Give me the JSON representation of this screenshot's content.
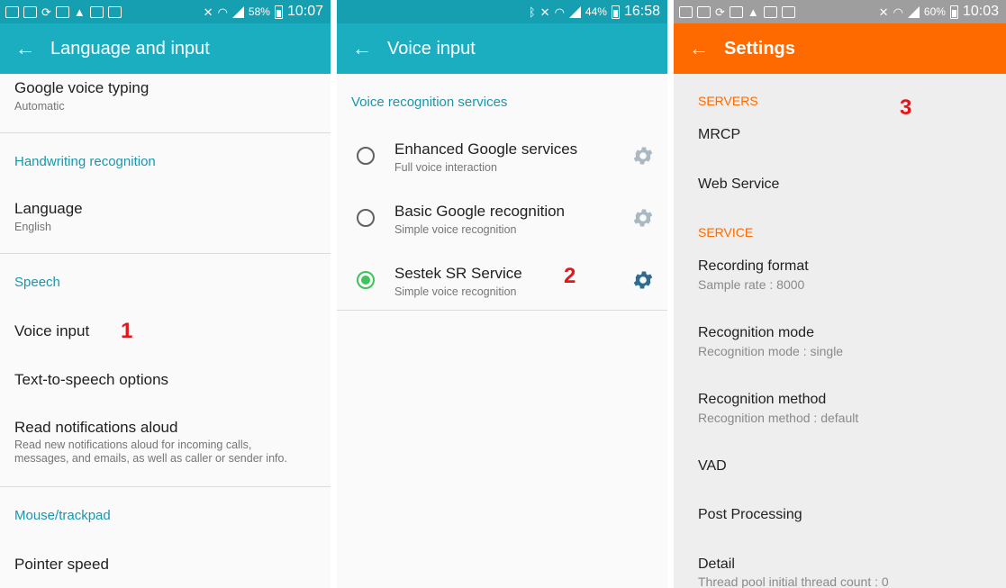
{
  "panel1": {
    "status_battery": "58%",
    "status_time": "10:07",
    "title": "Language and input",
    "google_voice_typing": {
      "title": "Google voice typing",
      "sub": "Automatic"
    },
    "handwriting_header": "Handwriting recognition",
    "language": {
      "title": "Language",
      "sub": "English"
    },
    "speech_header": "Speech",
    "voice_input": "Voice input",
    "marker": "1",
    "tts_options": "Text-to-speech options",
    "read_notifications": {
      "title": "Read notifications aloud",
      "sub1": "Read new notifications aloud for incoming calls,",
      "sub2": "messages, and emails, as well as caller or sender info."
    },
    "mouse_header": "Mouse/trackpad",
    "pointer_speed": "Pointer speed"
  },
  "panel2": {
    "status_battery": "44%",
    "status_time": "16:58",
    "title": "Voice input",
    "section_header": "Voice recognition services",
    "services": [
      {
        "title": "Enhanced Google services",
        "sub": "Full voice interaction",
        "selected": false
      },
      {
        "title": "Basic Google recognition",
        "sub": "Simple voice recognition",
        "selected": false
      },
      {
        "title": "Sestek SR Service",
        "sub": "Simple voice recognition",
        "selected": true
      }
    ],
    "marker": "2"
  },
  "panel3": {
    "status_battery": "60%",
    "status_time": "10:03",
    "title": "Settings",
    "servers_header": "SERVERS",
    "marker": "3",
    "mrcp": "MRCP",
    "web_service": "Web Service",
    "service_header": "SERVICE",
    "recording_format": {
      "title": "Recording format",
      "sub": "Sample rate : 8000"
    },
    "recognition_mode": {
      "title": "Recognition mode",
      "sub": "Recognition mode : single"
    },
    "recognition_method": {
      "title": "Recognition method",
      "sub": "Recognition method : default"
    },
    "vad": "VAD",
    "post_processing": "Post Processing",
    "detail": {
      "title": "Detail",
      "sub": "Thread pool initial thread count : 0"
    }
  },
  "icons": {
    "back": "arrow-left-icon",
    "gear": "gear-icon",
    "radio": "radio-button-icon"
  },
  "colors": {
    "teal": "#1aaec0",
    "orange": "#ff6a00",
    "selected_green": "#3fc35b",
    "active_gear": "#2e6d8e",
    "inactive_gear": "#aab8c2",
    "marker_red": "#e3161b"
  }
}
